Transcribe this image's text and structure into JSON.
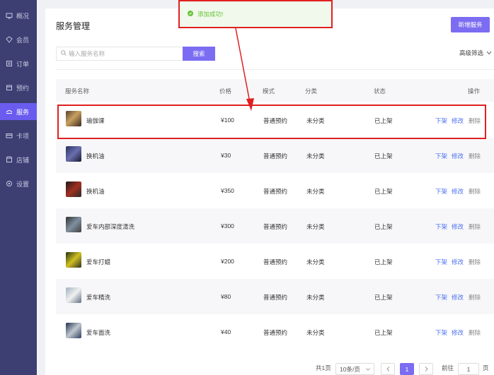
{
  "sidebar": {
    "items": [
      {
        "label": "概况",
        "icon": "monitor-icon"
      },
      {
        "label": "会员",
        "icon": "member-icon"
      },
      {
        "label": "订单",
        "icon": "order-icon"
      },
      {
        "label": "预约",
        "icon": "calendar-icon"
      },
      {
        "label": "服务",
        "icon": "service-icon",
        "active": true
      },
      {
        "label": "卡项",
        "icon": "card-icon"
      },
      {
        "label": "店铺",
        "icon": "store-icon"
      },
      {
        "label": "设置",
        "icon": "gear-icon"
      }
    ]
  },
  "header": {
    "title": "服务管理",
    "add_label": "新增服务"
  },
  "search": {
    "placeholder": "输入服务名称",
    "button_label": "搜索"
  },
  "filter": {
    "label": "高级筛选"
  },
  "table": {
    "columns": [
      "服务名称",
      "价格",
      "模式",
      "分类",
      "状态",
      "操作"
    ],
    "rows": [
      {
        "name": "瑜伽课",
        "price": "¥100",
        "mode": "普通预约",
        "category": "未分类",
        "status": "已上架"
      },
      {
        "name": "换机油",
        "price": "¥30",
        "mode": "普通预约",
        "category": "未分类",
        "status": "已上架"
      },
      {
        "name": "换机油",
        "price": "¥350",
        "mode": "普通预约",
        "category": "未分类",
        "status": "已上架"
      },
      {
        "name": "爱车内部深度清洗",
        "price": "¥300",
        "mode": "普通预约",
        "category": "未分类",
        "status": "已上架"
      },
      {
        "name": "爱车打蜡",
        "price": "¥200",
        "mode": "普通预约",
        "category": "未分类",
        "status": "已上架"
      },
      {
        "name": "爱车精洗",
        "price": "¥80",
        "mode": "普通预约",
        "category": "未分类",
        "status": "已上架"
      },
      {
        "name": "爱车面洗",
        "price": "¥40",
        "mode": "普通预约",
        "category": "未分类",
        "status": "已上架"
      }
    ],
    "actions": {
      "unlist": "下架",
      "edit": "修改",
      "delete": "删除"
    }
  },
  "pagination": {
    "total": "共1页",
    "page_size": "10条/页",
    "current": "1",
    "goto_label": "前往",
    "goto_value": "1",
    "page_suffix": "页"
  },
  "toast": {
    "message": "添加成功!"
  },
  "colors": {
    "sidebar_bg": "#3d3f73",
    "accent": "#7b6cf2",
    "link": "#4a6ef0",
    "success": "#67c23a",
    "annotation": "#e02020"
  }
}
